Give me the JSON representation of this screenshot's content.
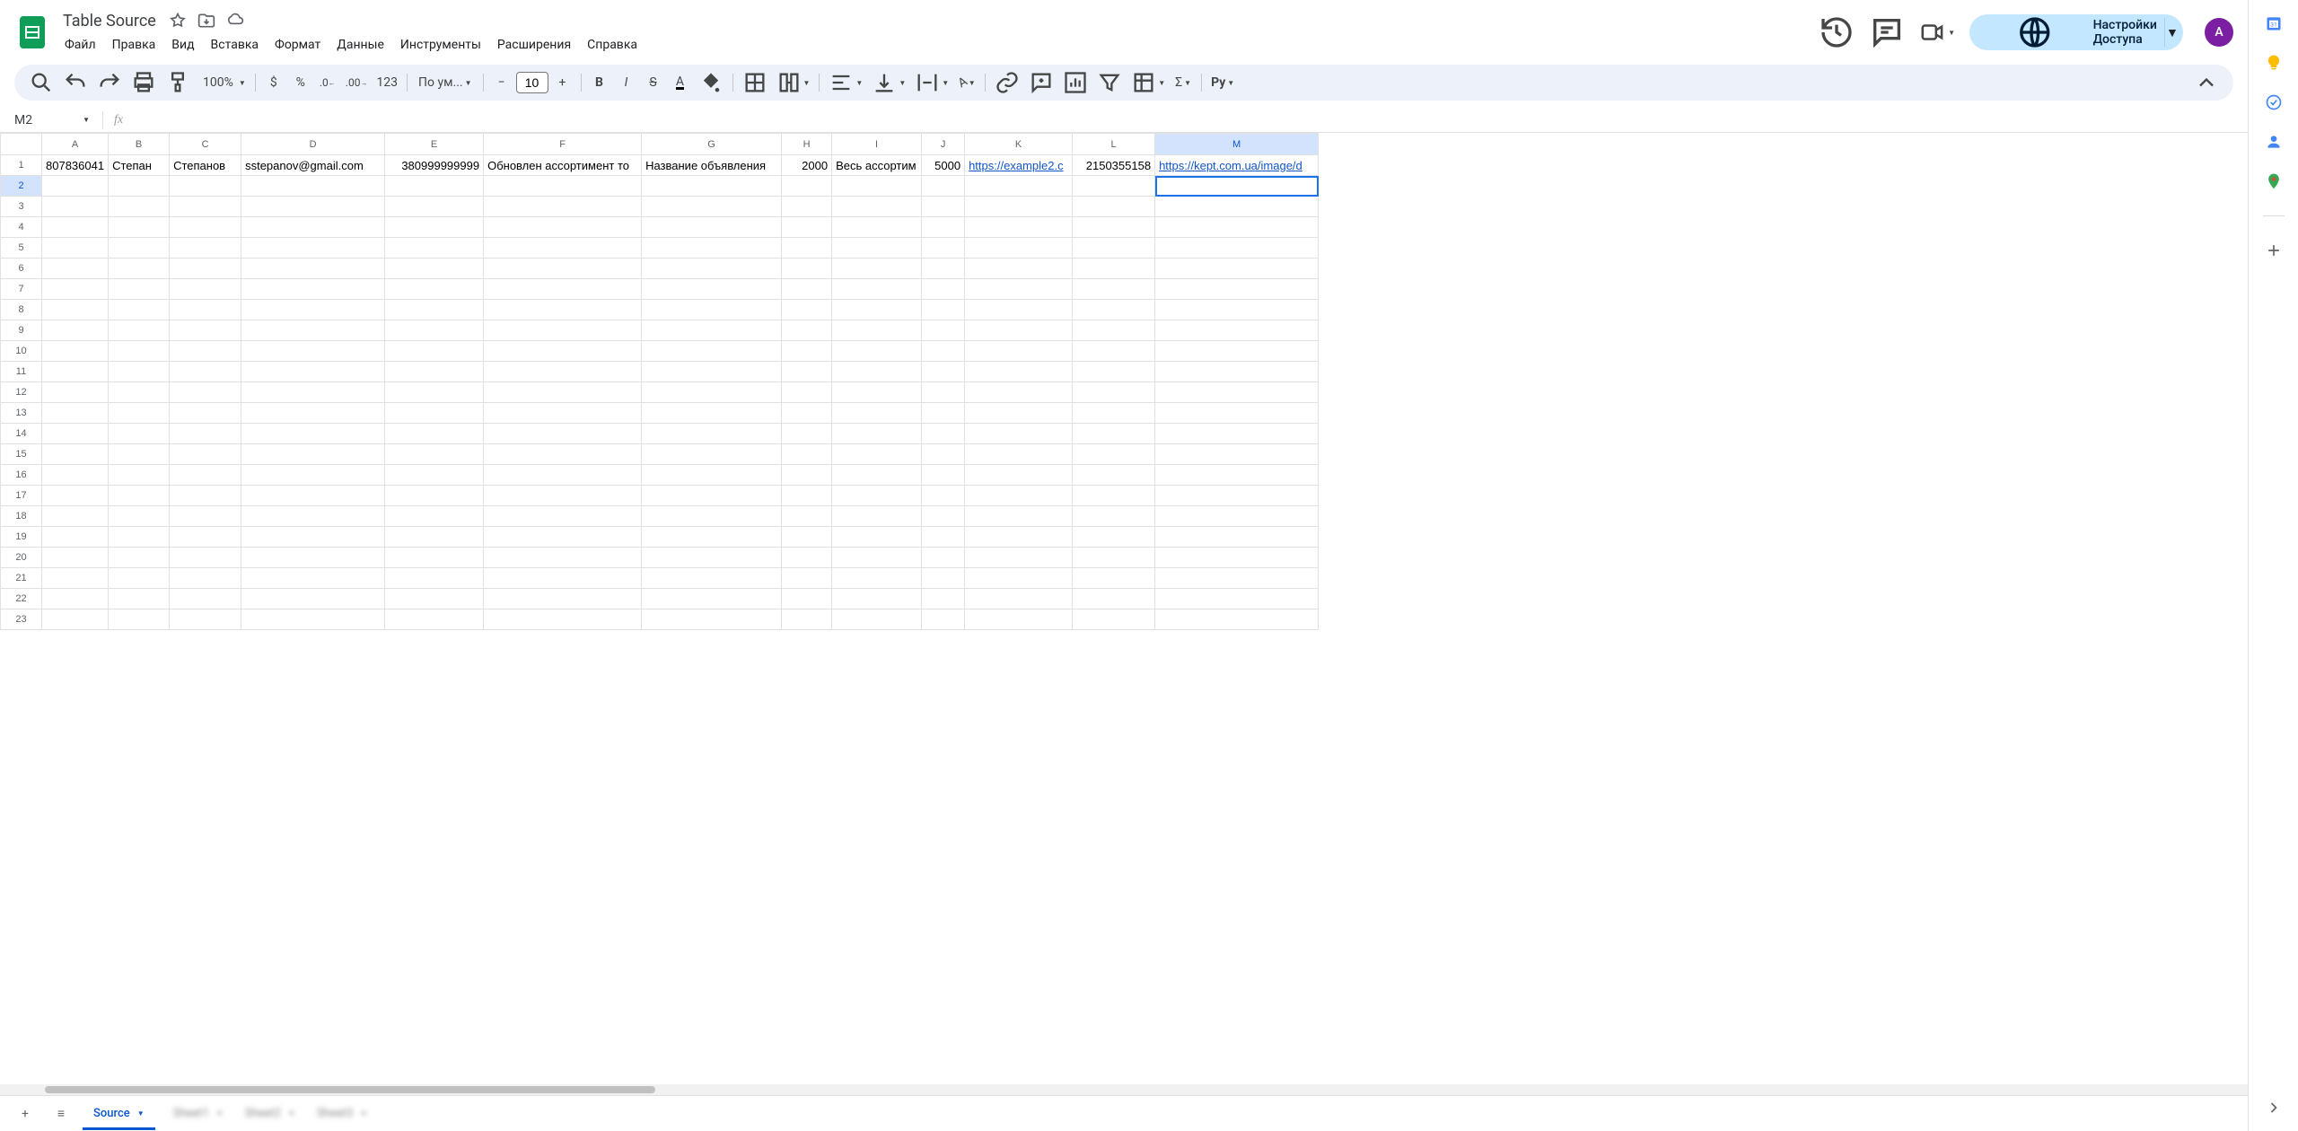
{
  "doc": {
    "title": "Table Source"
  },
  "menus": [
    "Файл",
    "Правка",
    "Вид",
    "Вставка",
    "Формат",
    "Данные",
    "Инструменты",
    "Расширения",
    "Справка"
  ],
  "share": {
    "label": "Настройки Доступа"
  },
  "avatar": {
    "letter": "A"
  },
  "toolbar": {
    "zoom": "100%",
    "font": "По ум...",
    "font_size": "10",
    "py_prefix": "Py"
  },
  "namebox": {
    "value": "M2"
  },
  "formula": {
    "value": ""
  },
  "sheet": {
    "columns": [
      "A",
      "B",
      "C",
      "D",
      "E",
      "F",
      "G",
      "H",
      "I",
      "J",
      "K",
      "L",
      "M"
    ],
    "row_count": 23,
    "selected": {
      "col": "M",
      "row": 2
    },
    "data_rows": [
      {
        "A": {
          "v": "807836041",
          "align": "num"
        },
        "B": {
          "v": "Степан"
        },
        "C": {
          "v": "Степанов"
        },
        "D": {
          "v": "sstepanov@gmail.com"
        },
        "E": {
          "v": "380999999999",
          "align": "num"
        },
        "F": {
          "v": "Обновлен ассортимент то"
        },
        "G": {
          "v": "Название объявления"
        },
        "H": {
          "v": "2000",
          "align": "num"
        },
        "I": {
          "v": "Весь ассортим"
        },
        "J": {
          "v": "5000",
          "align": "num"
        },
        "K": {
          "v": "https://example2.c",
          "link": true
        },
        "L": {
          "v": "2150355158",
          "align": "num"
        },
        "M": {
          "v": "https://kept.com.ua/image/d",
          "link": true
        }
      }
    ]
  },
  "tabs": {
    "active": "Source",
    "others": [
      "Sheet1",
      "Sheet2",
      "Sheet3"
    ]
  }
}
